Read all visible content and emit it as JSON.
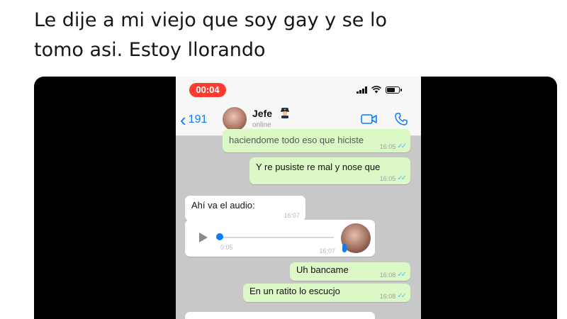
{
  "caption": {
    "line1": "Le dije a mi viejo que soy gay y se lo",
    "line2": "tomo asi. Estoy llorando"
  },
  "phone": {
    "status_bar": {
      "record_time": "00:04"
    },
    "chat_header": {
      "back_count": "191",
      "contact_name": "Jefe",
      "contact_status": "online"
    },
    "messages": [
      {
        "side": "out",
        "text": "haciendome todo eso que hiciste",
        "time": "16:05"
      },
      {
        "side": "out",
        "text": "Y re pusiste re mal y nose que",
        "time": "16:05"
      },
      {
        "side": "in",
        "text": "Ahí va el audio:",
        "time": "16:07"
      },
      {
        "side": "in",
        "type": "audio",
        "duration": "0:05",
        "time": "16:07"
      },
      {
        "side": "out",
        "text": "Uh bancame",
        "time": "16:08"
      },
      {
        "side": "out",
        "text": "En un ratito lo escucjo",
        "time": "16:08"
      }
    ]
  },
  "colors": {
    "outgoing_bubble": "#dcf8c6",
    "incoming_bubble": "#ffffff",
    "chat_background": "#c8c8c8",
    "ios_blue": "#0a7cff",
    "record_pill": "#ff3b30"
  }
}
